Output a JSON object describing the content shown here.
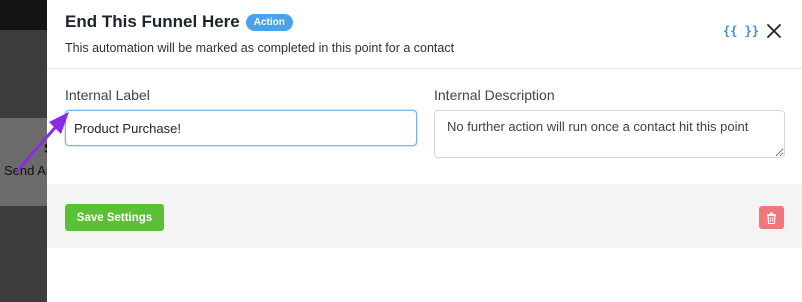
{
  "background": {
    "fragment_1": "S",
    "fragment_2": "Send Au"
  },
  "drawer": {
    "title": "End This Funnel Here",
    "badge": "Action",
    "subtitle": "This automation will be marked as completed in this point for a contact",
    "vars_icon_text": "{{ }}",
    "icons": {
      "vars": "curly-braces-icon",
      "close": "close-icon",
      "delete": "trash-icon"
    }
  },
  "form": {
    "internal_label": {
      "label": "Internal Label",
      "value": "Product Purchase!"
    },
    "internal_description": {
      "label": "Internal Description",
      "value": "No further action will run once a contact hit this point"
    }
  },
  "footer": {
    "save_label": "Save Settings"
  },
  "colors": {
    "badge": "#4aa3ea",
    "save_button": "#5ac137",
    "delete_button": "#f0777a",
    "annotation_arrow": "#8a2be2"
  }
}
